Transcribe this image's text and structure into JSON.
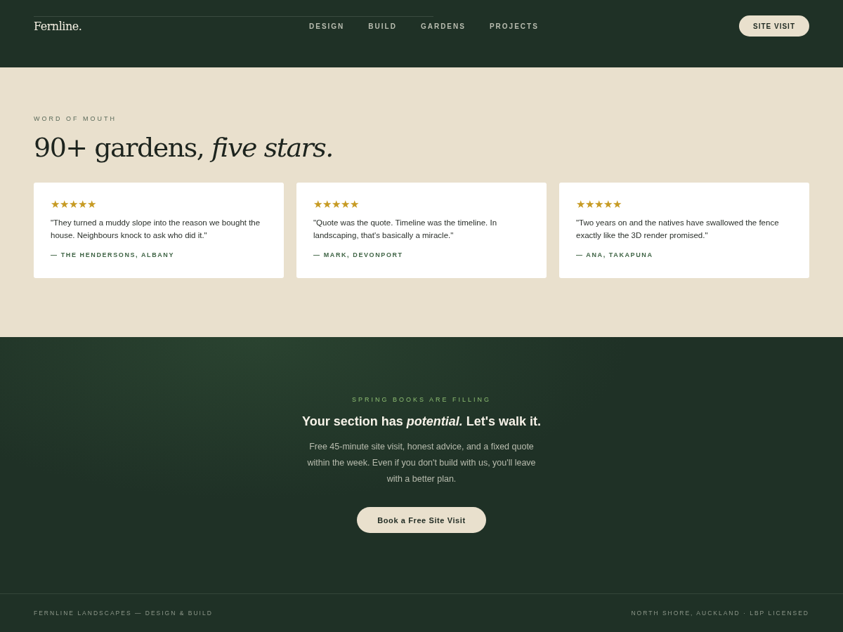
{
  "header": {
    "logo": "Fernline.",
    "nav": [
      {
        "label": "DESIGN"
      },
      {
        "label": "BUILD"
      },
      {
        "label": "GARDENS"
      },
      {
        "label": "PROJECTS"
      }
    ],
    "cta": "SITE VISIT"
  },
  "testimonials": {
    "eyebrow": "WORD OF MOUTH",
    "heading": "90+ gardens, *five stars.*",
    "items": [
      {
        "stars": 5,
        "quote": "\"They turned a muddy slope into the reason we bought the house. Neighbours knock to ask who did it.\"",
        "author": "— THE HENDERSONS, ALBANY"
      },
      {
        "stars": 5,
        "quote": "\"Quote was the quote. Timeline was the timeline. In landscaping, that's basically a miracle.\"",
        "author": "— MARK, DEVONPORT"
      },
      {
        "stars": 5,
        "quote": "\"Two years on and the natives have swallowed the fence exactly like the 3D render promised.\"",
        "author": "— ANA, TAKAPUNA"
      }
    ]
  },
  "cta": {
    "eyebrow": "SPRING BOOKS ARE FILLING",
    "heading": "Your section has *potential.* Let's walk it.",
    "body": "Free 45-minute site visit, honest advice, and a fixed quote within the week. Even if you don't build with us, you'll leave with a better plan.",
    "button": "Book a Free Site Visit"
  },
  "footer": {
    "left": "FERNLINE LANDSCAPES — DESIGN & BUILD",
    "right": "NORTH SHORE, AUCKLAND · LBP LICENSED"
  }
}
